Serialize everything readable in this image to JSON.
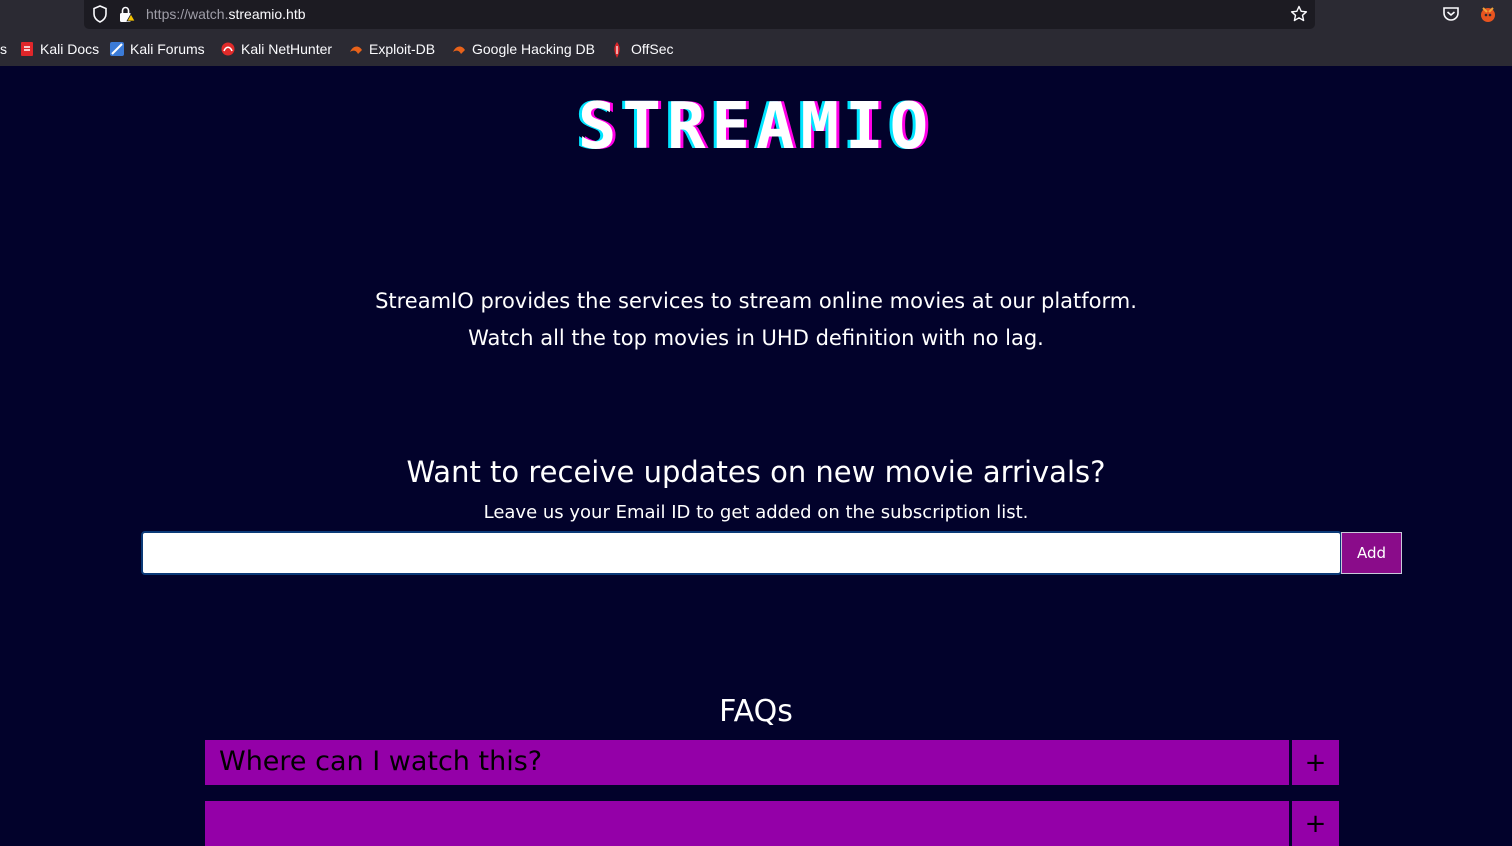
{
  "browser": {
    "url_prefix": "https://watch.",
    "url_domain": "streamio.htb",
    "bookmarks": [
      {
        "label": "s",
        "icon": "none"
      },
      {
        "label": "Kali Docs",
        "icon": "kali-docs-icon"
      },
      {
        "label": "Kali Forums",
        "icon": "kali-forums-icon"
      },
      {
        "label": "Kali NetHunter",
        "icon": "kali-nethunter-icon"
      },
      {
        "label": "Exploit-DB",
        "icon": "exploit-db-icon"
      },
      {
        "label": "Google Hacking DB",
        "icon": "ghdb-icon"
      },
      {
        "label": "OffSec",
        "icon": "offsec-icon"
      }
    ],
    "colors": {
      "chrome": "#2b2a33",
      "urlbar": "#1c1b22"
    }
  },
  "page": {
    "logo": "STREAMIO",
    "intro_line1": "StreamIO provides the services to stream online movies at our platform.",
    "intro_line2": "Watch all the top movies in UHD definition with no lag.",
    "subscribe": {
      "title": "Want to receive updates on new movie arrivals?",
      "description": "Leave us your Email ID to get added on the subscription list.",
      "email_value": "",
      "button_label": "Add"
    },
    "faqs": {
      "title": "FAQs",
      "items": [
        {
          "question": "Where can I watch this?",
          "toggle": "+"
        },
        {
          "question": "",
          "toggle": "+"
        }
      ]
    },
    "colors": {
      "background": "#02022b",
      "accent": "#9400a8",
      "button": "#8a0c8a"
    }
  }
}
